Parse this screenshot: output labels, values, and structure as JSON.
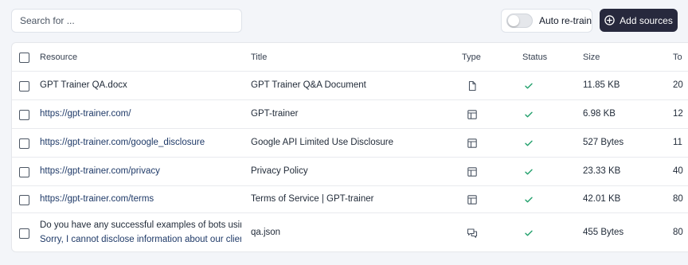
{
  "search": {
    "placeholder": "Search for ..."
  },
  "toolbar": {
    "auto_retrain_label": "Auto re-train",
    "auto_retrain_on": false,
    "add_sources_label": "Add sources"
  },
  "table": {
    "columns": {
      "resource": "Resource",
      "title": "Title",
      "type": "Type",
      "status": "Status",
      "size": "Size",
      "truncated": "To"
    },
    "rows": [
      {
        "resource": "GPT Trainer QA.docx",
        "title": "GPT Trainer Q&A Document",
        "type_icon": "document-icon",
        "status_icon": "check-icon",
        "size": "11.85 KB",
        "truncated": "20"
      },
      {
        "resource": "https://gpt-trainer.com/",
        "title": "GPT-trainer",
        "type_icon": "webpage-icon",
        "status_icon": "check-icon",
        "size": "6.98 KB",
        "truncated": "12"
      },
      {
        "resource": "https://gpt-trainer.com/google_disclosure",
        "title": "Google API Limited Use Disclosure",
        "type_icon": "webpage-icon",
        "status_icon": "check-icon",
        "size": "527 Bytes",
        "truncated": "11"
      },
      {
        "resource": "https://gpt-trainer.com/privacy",
        "title": "Privacy Policy",
        "type_icon": "webpage-icon",
        "status_icon": "check-icon",
        "size": "23.33 KB",
        "truncated": "40"
      },
      {
        "resource": "https://gpt-trainer.com/terms",
        "title": "Terms of Service | GPT-trainer",
        "type_icon": "webpage-icon",
        "status_icon": "check-icon",
        "size": "42.01 KB",
        "truncated": "80"
      },
      {
        "resource": "Do you have any successful examples of bots using",
        "resource_sub": "Sorry, I cannot disclose information about our clients",
        "title": "qa.json",
        "type_icon": "qa-chat-icon",
        "status_icon": "check-icon",
        "size": "455 Bytes",
        "truncated": "80"
      }
    ]
  },
  "colors": {
    "background": "#f3f5f9",
    "primary_button": "#27293d",
    "link": "#1f3a68",
    "success": "#22a06b"
  }
}
